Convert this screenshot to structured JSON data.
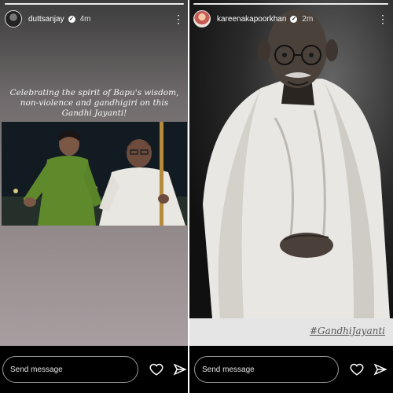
{
  "stories": {
    "left": {
      "username": "duttsanjay",
      "timestamp": "4m",
      "caption": "Celebrating the spirit of Bapu's wisdom, non-violence and gandhigiri on this Gandhi Jayanti!",
      "reply_placeholder": "Send message"
    },
    "right": {
      "username": "kareenakapoorkhan",
      "timestamp": "2m",
      "hashtag": "#GandhiJayanti",
      "reply_placeholder": "Send message"
    }
  },
  "icons": {
    "verified": "verified-badge-icon",
    "more": "more-options-icon",
    "like": "heart-icon",
    "share": "send-icon"
  }
}
